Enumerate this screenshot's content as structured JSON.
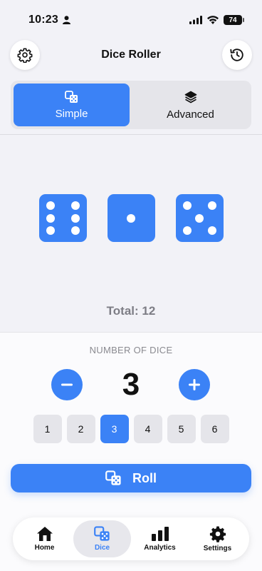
{
  "status_bar": {
    "time": "10:23",
    "battery": "74"
  },
  "header": {
    "title": "Dice Roller",
    "settings_icon": "gear-icon",
    "history_icon": "history-icon"
  },
  "mode_tabs": [
    {
      "label": "Simple",
      "icon": "dice-icon",
      "active": true
    },
    {
      "label": "Advanced",
      "icon": "layers-icon",
      "active": false
    }
  ],
  "dice": {
    "faces": [
      6,
      1,
      5
    ],
    "total_label": "Total: 12",
    "color": "#3b82f6"
  },
  "dice_count": {
    "label": "NUMBER OF DICE",
    "value": "3",
    "minus_icon": "minus-icon",
    "plus_icon": "plus-icon",
    "options": [
      "1",
      "2",
      "3",
      "4",
      "5",
      "6"
    ],
    "selected": "3"
  },
  "roll_button": {
    "label": "Roll",
    "icon": "dice-icon"
  },
  "tab_bar": [
    {
      "label": "Home",
      "icon": "home-icon",
      "active": false
    },
    {
      "label": "Dice",
      "icon": "dice-icon",
      "active": true
    },
    {
      "label": "Analytics",
      "icon": "bar-chart-icon",
      "active": false
    },
    {
      "label": "Settings",
      "icon": "gear-icon",
      "active": false
    }
  ],
  "colors": {
    "accent": "#3b82f6",
    "background": "#f2f2f7"
  }
}
